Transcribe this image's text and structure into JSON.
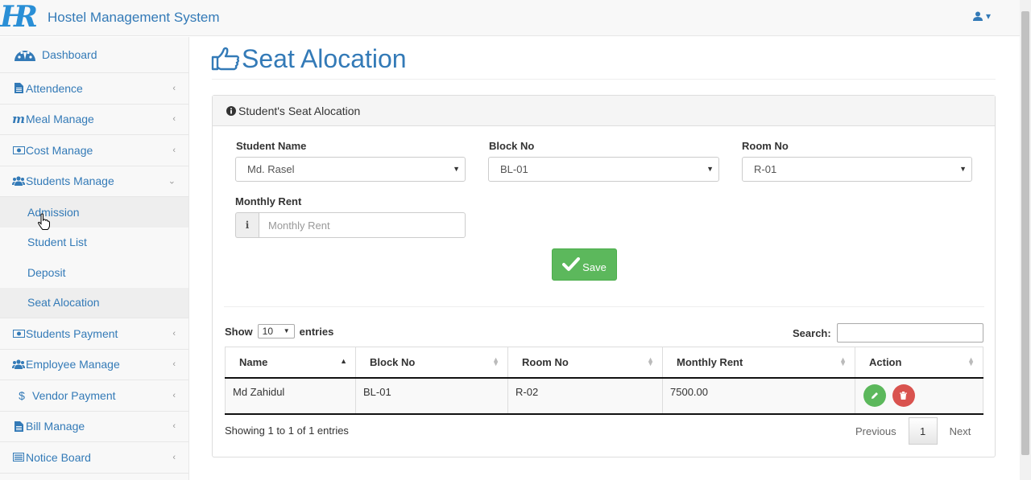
{
  "app": {
    "title": "Hostel Management System",
    "brand_color": "#337ab7"
  },
  "sidebar": {
    "items": [
      {
        "label": "Dashboard",
        "icon": "dashboard-icon"
      },
      {
        "label": "Attendence",
        "icon": "file-icon"
      },
      {
        "label": "Meal Manage",
        "icon": "meal-m-icon"
      },
      {
        "label": "Cost Manage",
        "icon": "money-icon"
      },
      {
        "label": "Students Manage",
        "icon": "users-icon",
        "expanded": true,
        "subitems": [
          "Admission",
          "Student List",
          "Deposit",
          "Seat Alocation"
        ]
      },
      {
        "label": "Students Payment",
        "icon": "money-icon"
      },
      {
        "label": "Employee Manage",
        "icon": "users-icon"
      },
      {
        "label": "Vendor Payment",
        "icon": "dollar-icon"
      },
      {
        "label": "Bill Manage",
        "icon": "file-icon"
      },
      {
        "label": "Notice Board",
        "icon": "list-icon"
      }
    ]
  },
  "page": {
    "title": "Seat Alocation"
  },
  "panel": {
    "heading": "Student's Seat Alocation",
    "form": {
      "student_name_label": "Student Name",
      "student_name_value": "Md. Rasel",
      "block_no_label": "Block No",
      "block_no_value": "BL-01",
      "room_no_label": "Room No",
      "room_no_value": "R-01",
      "monthly_rent_label": "Monthly Rent",
      "monthly_rent_placeholder": "Monthly Rent",
      "rent_addon": "i",
      "save_label": "Save"
    }
  },
  "table": {
    "show_label": "Show",
    "entries_value": "10",
    "entries_label": "entries",
    "search_label": "Search:",
    "columns": [
      "Name",
      "Block No",
      "Room No",
      "Monthly Rent",
      "Action"
    ],
    "rows": [
      {
        "name": "Md Zahidul",
        "block": "BL-01",
        "room": "R-02",
        "rent": "7500.00"
      }
    ],
    "info": "Showing 1 to 1 of 1 entries",
    "pagination": {
      "previous": "Previous",
      "page": "1",
      "next": "Next"
    }
  },
  "colors": {
    "save": "#5cb85c",
    "delete": "#d9534f"
  }
}
